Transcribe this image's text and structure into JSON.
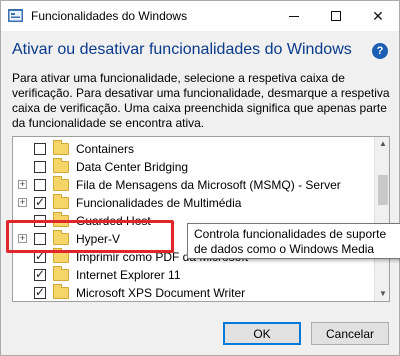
{
  "window": {
    "title": "Funcionalidades do Windows"
  },
  "titlebar": {
    "minimize": "minimize-icon",
    "maximize": "maximize-icon",
    "close_glyph": "✕"
  },
  "header": {
    "heading": "Ativar ou desativar funcionalidades do Windows",
    "help_glyph": "?"
  },
  "description": "Para ativar uma funcionalidade, selecione a respetiva caixa de verificação. Para desativar uma funcionalidade, desmarque a respetiva caixa de verificação. Uma caixa preenchida significa que apenas parte da funcionalidade se encontra ativa.",
  "features": [
    {
      "label": "Containers",
      "expandable": false,
      "checked": false
    },
    {
      "label": "Data Center Bridging",
      "expandable": false,
      "checked": false
    },
    {
      "label": "Fila de Mensagens da Microsoft (MSMQ) - Server",
      "expandable": true,
      "checked": false
    },
    {
      "label": "Funcionalidades de Multimédia",
      "expandable": true,
      "checked": true
    },
    {
      "label": "Guarded Host",
      "expandable": false,
      "checked": false
    },
    {
      "label": "Hyper-V",
      "expandable": true,
      "checked": false
    },
    {
      "label": "Imprimir como PDF da Microsoft",
      "expandable": false,
      "checked": true
    },
    {
      "label": "Internet Explorer 11",
      "expandable": false,
      "checked": true
    },
    {
      "label": "Microsoft XPS Document Writer",
      "expandable": false,
      "checked": true
    }
  ],
  "tooltip": "Controla funcionalidades de suporte de dados como o Windows Media Player.",
  "buttons": {
    "ok": "OK",
    "cancel": "Cancelar"
  },
  "colors": {
    "heading": "#0a3a8c",
    "highlight": "#e0262a",
    "ok_border": "#0078d7"
  }
}
